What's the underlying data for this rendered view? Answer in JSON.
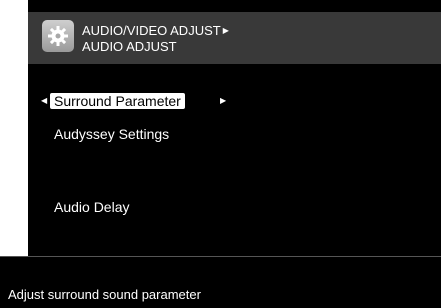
{
  "header": {
    "icon": "gear-icon",
    "breadcrumb_parent": "AUDIO/VIDEO ADJUST",
    "breadcrumb_current": "AUDIO ADJUST"
  },
  "menu": {
    "items": [
      {
        "label": "Surround Parameter",
        "selected": true
      },
      {
        "label": "Audyssey Settings",
        "selected": false
      },
      {
        "label": "Audio Delay",
        "selected": false
      }
    ],
    "selection_left_icon": "caret-left-icon",
    "selection_right_icon": "caret-right-icon"
  },
  "help": {
    "text": "Adjust surround sound parameter"
  },
  "colors": {
    "screen_background": "#000000",
    "header_background": "#393939",
    "text": "#ffffff",
    "selection_background": "#ffffff",
    "selection_text": "#000000"
  }
}
